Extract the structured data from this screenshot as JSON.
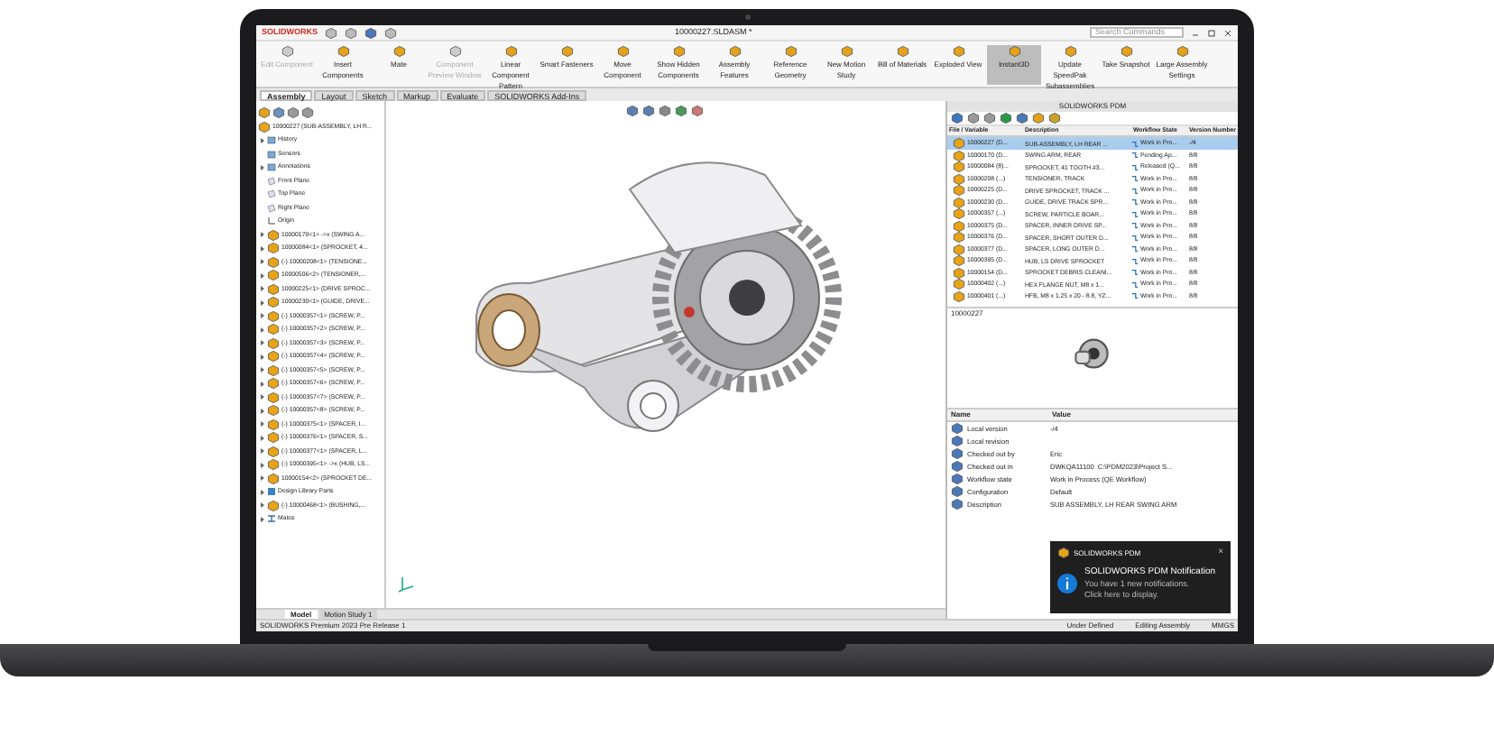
{
  "app_logo": "SOLIDWORKS",
  "document_title": "10000227.SLDASM *",
  "search": {
    "placeholder": "Search Commands"
  },
  "ribbon": [
    {
      "label": "Edit Component",
      "disabled": true,
      "selected": false
    },
    {
      "label": "Insert Components",
      "disabled": false,
      "selected": false
    },
    {
      "label": "Mate",
      "disabled": false,
      "selected": false
    },
    {
      "label": "Component Preview Window",
      "disabled": true,
      "selected": false
    },
    {
      "label": "Linear Component Pattern",
      "disabled": false,
      "selected": false
    },
    {
      "label": "Smart Fasteners",
      "disabled": false,
      "selected": false
    },
    {
      "label": "Move Component",
      "disabled": false,
      "selected": false
    },
    {
      "label": "Show Hidden Components",
      "disabled": false,
      "selected": false
    },
    {
      "label": "Assembly Features",
      "disabled": false,
      "selected": false
    },
    {
      "label": "Reference Geometry",
      "disabled": false,
      "selected": false
    },
    {
      "label": "New Motion Study",
      "disabled": false,
      "selected": false
    },
    {
      "label": "Bill of Materials",
      "disabled": false,
      "selected": false
    },
    {
      "label": "Exploded View",
      "disabled": false,
      "selected": false
    },
    {
      "label": "Instant3D",
      "disabled": false,
      "selected": true
    },
    {
      "label": "Update SpeedPak Subassemblies",
      "disabled": false,
      "selected": false
    },
    {
      "label": "Take Snapshot",
      "disabled": false,
      "selected": false
    },
    {
      "label": "Large Assembly Settings",
      "disabled": false,
      "selected": false
    }
  ],
  "tabs": [
    {
      "label": "Assembly",
      "selected": true
    },
    {
      "label": "Layout",
      "selected": false
    },
    {
      "label": "Sketch",
      "selected": false
    },
    {
      "label": "Markup",
      "selected": false
    },
    {
      "label": "Evaluate",
      "selected": false
    },
    {
      "label": "SOLIDWORKS Add-Ins",
      "selected": false
    }
  ],
  "feature_tree": {
    "label": "10000227 (SUB-ASSEMBLY, LH R...",
    "children": [
      {
        "label": "History",
        "kind": "folder",
        "expandable": true
      },
      {
        "label": "Sensors",
        "kind": "folder",
        "expandable": false
      },
      {
        "label": "Annotations",
        "kind": "folder",
        "expandable": true
      },
      {
        "label": "Front Plane",
        "kind": "plane",
        "expandable": false
      },
      {
        "label": "Top Plane",
        "kind": "plane",
        "expandable": false
      },
      {
        "label": "Right Plane",
        "kind": "plane",
        "expandable": false
      },
      {
        "label": "Origin",
        "kind": "origin",
        "expandable": false
      },
      {
        "label": "10000170<1> ->x (SWING A...",
        "kind": "part",
        "expandable": true
      },
      {
        "label": "10000084<1> (SPROCKET, 4...",
        "kind": "part",
        "expandable": true
      },
      {
        "label": "(-) 10000208<1> (TENSIONE...",
        "kind": "part",
        "expandable": true
      },
      {
        "label": "10000506<2> (TENSIONER,...",
        "kind": "part",
        "expandable": true
      },
      {
        "label": "10000225<1> (DRIVE SPROC...",
        "kind": "part",
        "expandable": true
      },
      {
        "label": "10000230<1> (GUIDE, DRIVE...",
        "kind": "part",
        "expandable": true
      },
      {
        "label": "(-) 10000357<1> (SCREW, P...",
        "kind": "part",
        "expandable": true
      },
      {
        "label": "(-) 10000357<2> (SCREW, P...",
        "kind": "part",
        "expandable": true
      },
      {
        "label": "(-) 10000357<3> (SCREW, P...",
        "kind": "part",
        "expandable": true
      },
      {
        "label": "(-) 10000357<4> (SCREW, P...",
        "kind": "part",
        "expandable": true
      },
      {
        "label": "(-) 10000357<5> (SCREW, P...",
        "kind": "part",
        "expandable": true
      },
      {
        "label": "(-) 10000357<6> (SCREW, P...",
        "kind": "part",
        "expandable": true
      },
      {
        "label": "(-) 10000357<7> (SCREW, P...",
        "kind": "part",
        "expandable": true
      },
      {
        "label": "(-) 10000357<8> (SCREW, P...",
        "kind": "part",
        "expandable": true
      },
      {
        "label": "(-) 10000375<1> (SPACER, I...",
        "kind": "part",
        "expandable": true
      },
      {
        "label": "(-) 10000376<1> (SPACER, S...",
        "kind": "part",
        "expandable": true
      },
      {
        "label": "(-) 10000377<1> (SPACER, L...",
        "kind": "part",
        "expandable": true
      },
      {
        "label": "(-) 10000395<1> ->x (HUB, LS...",
        "kind": "part",
        "expandable": true
      },
      {
        "label": "10000154<2> (SPROCKET DE...",
        "kind": "part",
        "expandable": true
      },
      {
        "label": "Design Library Parts",
        "kind": "library",
        "expandable": true
      },
      {
        "label": "(-) 10000468<1> (BUSHING,...",
        "kind": "part",
        "expandable": true
      },
      {
        "label": "Mates",
        "kind": "mates",
        "expandable": true
      }
    ]
  },
  "bottom_tabs": [
    {
      "label": "Model",
      "selected": true
    },
    {
      "label": "Motion Study 1",
      "selected": false
    }
  ],
  "pdm": {
    "title": "SOLIDWORKS PDM",
    "columns": [
      "File / Variable",
      "Description",
      "Workflow State",
      "Version Number"
    ],
    "rows": [
      {
        "file": "10000227 (D...",
        "description": "SUB-ASSEMBLY, LH REAR ...",
        "state": "Work in Pro...",
        "version": "-/4",
        "selected": true
      },
      {
        "file": "10000170 (D...",
        "description": "SWING ARM, REAR",
        "state": "Pending Ap...",
        "version": "8/8",
        "selected": false
      },
      {
        "file": "10000084 (8)...",
        "description": "SPROCKET, 41 TOOTH #3...",
        "state": "Released (Q...",
        "version": "8/8",
        "selected": false
      },
      {
        "file": "10000208 (...)",
        "description": "TENSIONER, TRACK",
        "state": "Work in Pro...",
        "version": "8/8",
        "selected": false
      },
      {
        "file": "10000225 (D...",
        "description": "DRIVE SPROCKET, TRACK ...",
        "state": "Work in Pro...",
        "version": "8/8",
        "selected": false
      },
      {
        "file": "10000230 (D...",
        "description": "GUIDE, DRIVE TRACK SPR...",
        "state": "Work in Pro...",
        "version": "8/8",
        "selected": false
      },
      {
        "file": "10000357 (...)",
        "description": "SCREW, PARTICLE BOAR...",
        "state": "Work in Pro...",
        "version": "8/8",
        "selected": false
      },
      {
        "file": "10000375 (D...",
        "description": "SPACER, INNER DRIVE SP...",
        "state": "Work in Pro...",
        "version": "8/8",
        "selected": false
      },
      {
        "file": "10000376 (D...",
        "description": "SPACER, SHORT OUTER D...",
        "state": "Work in Pro...",
        "version": "8/8",
        "selected": false
      },
      {
        "file": "10000377 (D...",
        "description": "SPACER, LONG OUTER D...",
        "state": "Work in Pro...",
        "version": "8/8",
        "selected": false
      },
      {
        "file": "10000395 (D...",
        "description": "HUB, LS DRIVE SPROCKET",
        "state": "Work in Pro...",
        "version": "8/8",
        "selected": false
      },
      {
        "file": "10000154 (D...",
        "description": "SPROCKET DEBRIS CLEANI...",
        "state": "Work in Pro...",
        "version": "8/8",
        "selected": false
      },
      {
        "file": "10000402 (...)",
        "description": "HEX FLANGE NUT, M8 x 1...",
        "state": "Work in Pro...",
        "version": "8/8",
        "selected": false
      },
      {
        "file": "10000401 (...)",
        "description": "HFB, M8 x 1.25 x 20 - 8.8, YZ...",
        "state": "Work in Pro...",
        "version": "8/8",
        "selected": false
      }
    ],
    "preview_label": "10000227",
    "property_columns": [
      "Name",
      "Value"
    ],
    "properties": [
      {
        "name": "Local version",
        "values": [
          "-/4"
        ]
      },
      {
        "name": "Local revision"
      },
      {
        "name": "Checked out by",
        "values": [
          "Eric"
        ]
      },
      {
        "name": "Checked out in",
        "values": [
          "DWKQA11100",
          "C:\\PDM2023\\Project S..."
        ]
      },
      {
        "name": "Workflow state",
        "values": [
          "Work in Process (QE Workflow)"
        ]
      },
      {
        "name": "Configuration",
        "values": [
          "Default"
        ]
      },
      {
        "name": "Description",
        "values": [
          "SUB ASSEMBLY, LH REAR SWING ARM"
        ]
      }
    ]
  },
  "notification": {
    "app": "SOLIDWORKS PDM",
    "close": "×",
    "title": "SOLIDWORKS PDM Notification",
    "message": "You have 1 new notifications.",
    "action": "Click here to display."
  },
  "status_bar": {
    "product": "SOLIDWORKS Premium 2023 Pre Release 1",
    "items": [
      "Under Defined",
      "Editing Assembly",
      "MMGS"
    ]
  }
}
